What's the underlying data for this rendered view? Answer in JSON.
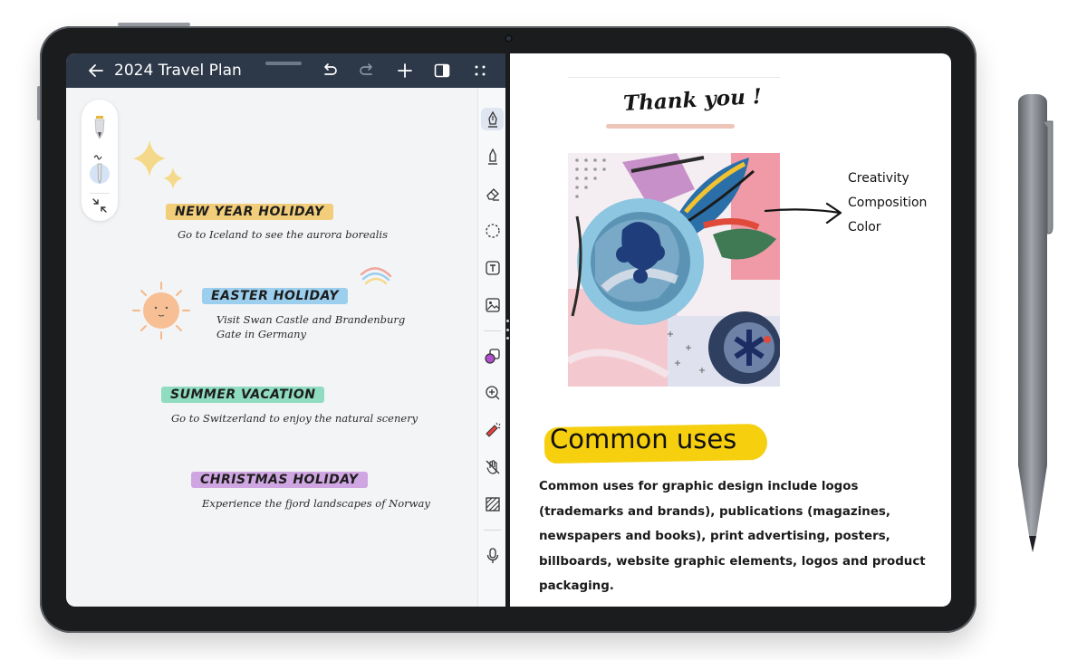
{
  "window": {
    "title": "2024 Travel Plan",
    "icons": [
      "back-arrow-icon",
      "undo-icon",
      "redo-icon",
      "add-icon",
      "split-view-icon",
      "more-icon"
    ]
  },
  "left_panel_tools": [
    "pen-icon",
    "pencil-icon",
    "collapse-icon"
  ],
  "tool_rail": [
    "fountain-pen-icon",
    "pencil-icon",
    "eraser-icon",
    "lasso-icon",
    "text-box-icon",
    "image-icon",
    "shape-icon",
    "zoom-icon",
    "highlighter-icon",
    "hand-icon",
    "texture-icon",
    "microphone-icon"
  ],
  "notes": [
    {
      "title": "NEW YEAR HOLIDAY",
      "text": "Go to Iceland to see the aurora borealis",
      "color": "#f2cd7a"
    },
    {
      "title": "EASTER HOLIDAY",
      "line1": "Visit Swan Castle and Brandenburg",
      "line2": "Gate in Germany",
      "color": "#9ccfee"
    },
    {
      "title": "SUMMER VACATION",
      "text": "Go to Switzerland to enjoy the natural scenery",
      "color": "#8fdcc1"
    },
    {
      "title": "CHRISTMAS HOLIDAY",
      "text": "Experience the fjord landscapes of Norway",
      "color": "#cfa6e1"
    }
  ],
  "document": {
    "thanks": "Thank you !",
    "labels": [
      "Creativity",
      "Composition",
      "Color"
    ],
    "heading": "Common uses",
    "body": "Common uses for graphic design include logos (trademarks and brands), publications (magazines, newspapers and books), print advertising, posters, billboards, website graphic elements, logos and product packaging."
  },
  "colors": {
    "titlebar": "#2d3848",
    "canvas": "#f3f4f6",
    "highlight": "#f6cf0f",
    "bezel": "#1b1c1e"
  }
}
